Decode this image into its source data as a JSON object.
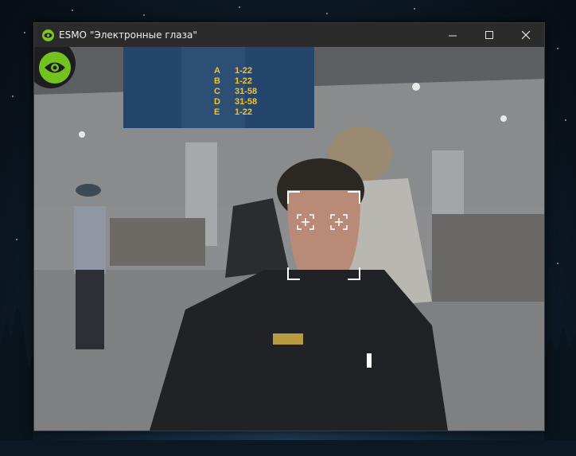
{
  "window": {
    "title": "ESMO \"Электронные глаза\"",
    "controls": {
      "minimize": "minimize",
      "maximize": "maximize",
      "close": "close"
    }
  },
  "overlay": {
    "icon": "eye-icon",
    "accent": "#7bc620"
  },
  "signboard": {
    "rows": [
      {
        "letter": "A",
        "gates": "1-22"
      },
      {
        "letter": "B",
        "gates": "1-22"
      },
      {
        "letter": "C",
        "gates": "31-58"
      },
      {
        "letter": "D",
        "gates": "31-58"
      },
      {
        "letter": "E",
        "gates": "1-22"
      }
    ]
  },
  "face_detection": {
    "frame": "face-frame",
    "markers": [
      "left-eye-marker",
      "right-eye-marker"
    ]
  }
}
